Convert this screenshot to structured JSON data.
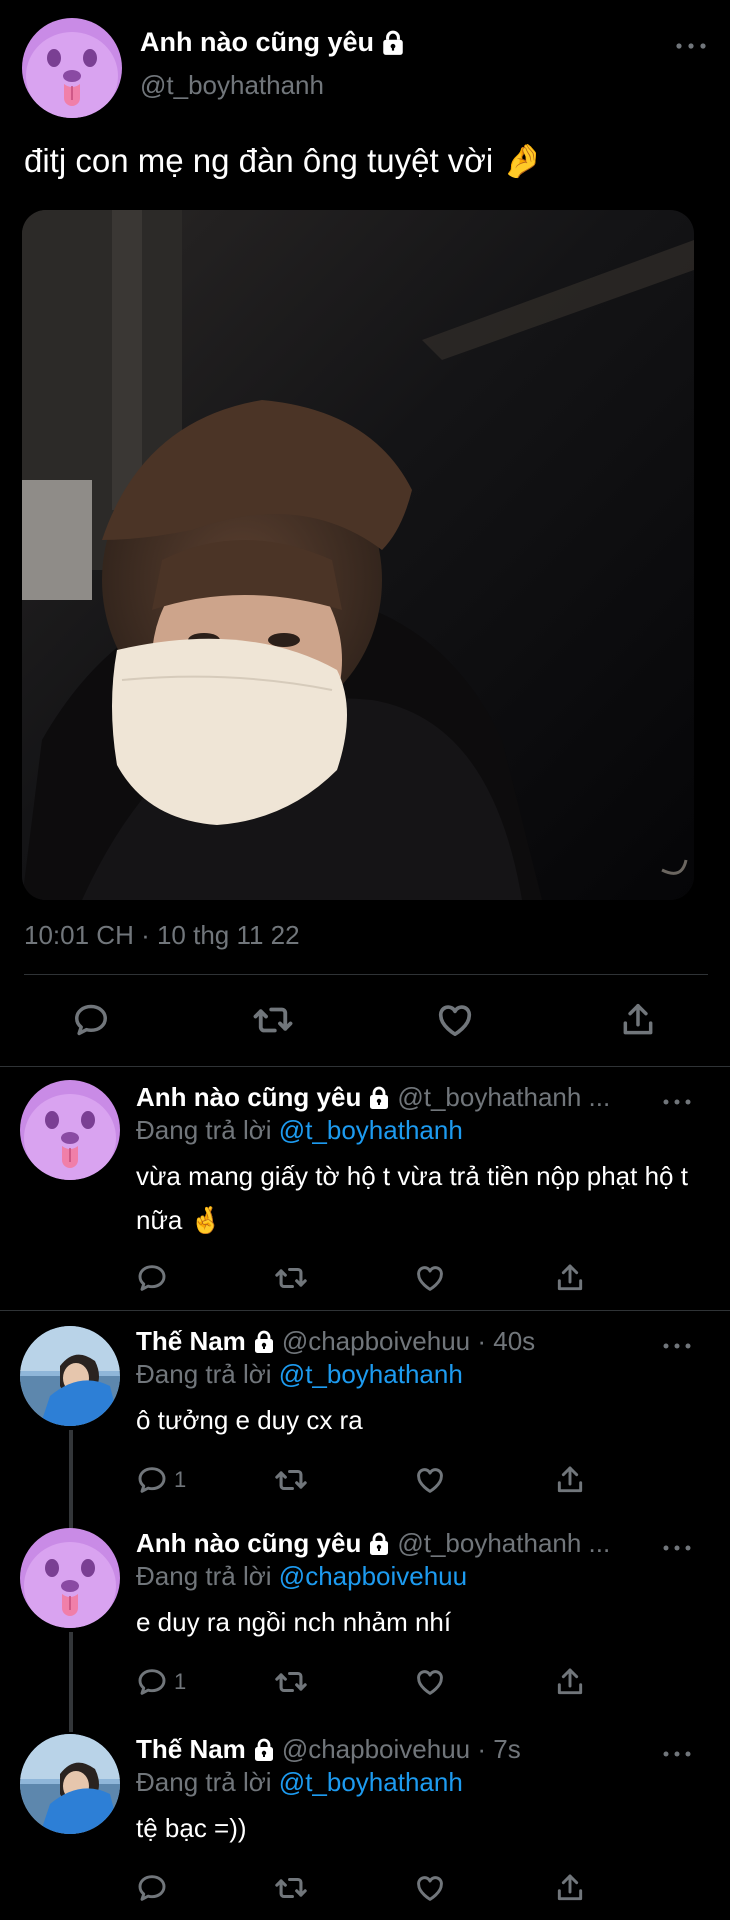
{
  "main_tweet": {
    "display_name": "Anh nào cũng yêu",
    "handle": "@t_boyhathanh",
    "text": "đitj con mẹ ng đàn ông tuyệt vời 🤌",
    "timestamp": "10:01 CH · 10 thg 11 22"
  },
  "replies": [
    {
      "display_name": "Anh nào cũng yêu",
      "meta": "@t_boyhathanh ...",
      "replying_label": "Đang trả lời",
      "replying_to": "@t_boyhathanh",
      "text": "vừa mang giấy tờ hộ t vừa trả tiền nộp phạt hộ t nữa 🤞",
      "reply_count": ""
    },
    {
      "display_name": "Thế Nam",
      "meta": "@chapboivehuu · 40s",
      "replying_label": "Đang trả lời",
      "replying_to": "@t_boyhathanh",
      "text": "ô tưởng e duy cx ra",
      "reply_count": "1"
    },
    {
      "display_name": "Anh nào cũng yêu",
      "meta": "@t_boyhathanh ...",
      "replying_label": "Đang trả lời",
      "replying_to": "@chapboivehuu",
      "text": "e duy ra ngồi nch nhảm nhí",
      "reply_count": "1"
    },
    {
      "display_name": "Thế Nam",
      "meta": "@chapboivehuu · 7s",
      "replying_label": "Đang trả lời",
      "replying_to": "@t_boyhathanh",
      "text": "tệ bạc =))",
      "reply_count": ""
    }
  ],
  "icons": {
    "reply": "reply-icon",
    "retweet": "retweet-icon",
    "like": "like-icon",
    "share": "share-icon",
    "more": "more-icon",
    "lock": "lock-icon"
  },
  "colors": {
    "background": "#000000",
    "text": "#e7e9ea",
    "muted": "#71767b",
    "link": "#1d9bf0",
    "divider": "#2f3336"
  }
}
